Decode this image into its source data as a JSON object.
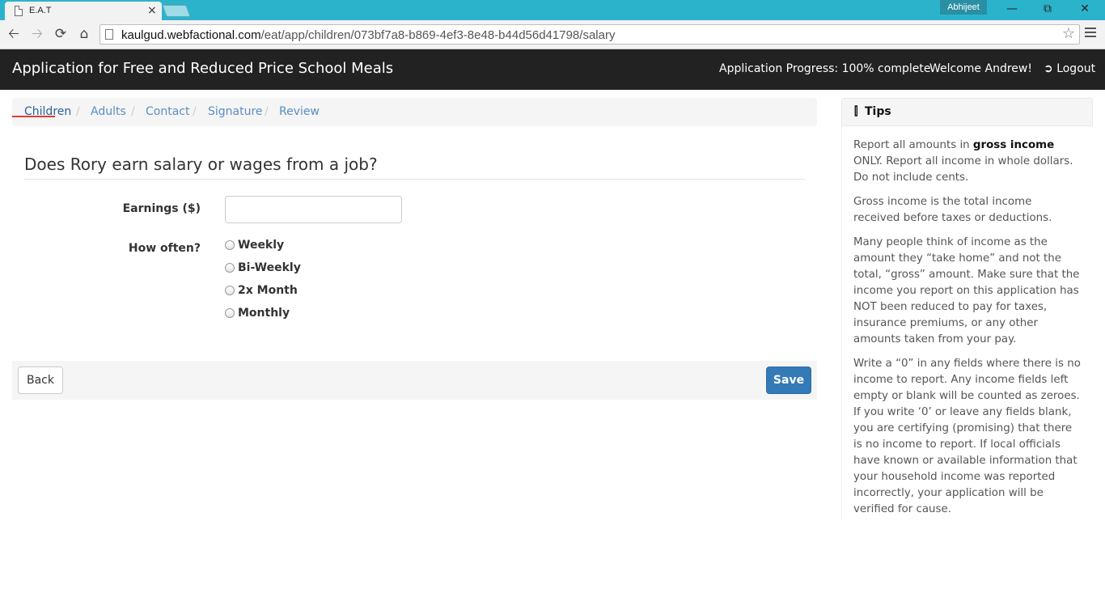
{
  "browser": {
    "tab_title": "E.A.T",
    "tab_close": "×",
    "profile_name": "Abhijeet",
    "url_host": "kaulgud.webfactional.com",
    "url_path": "/eat/app/children/073bf7a8-b869-4ef3-8e48-b44d56d41798/salary"
  },
  "navbar": {
    "brand": "Application for Free and Reduced Price School Meals",
    "progress": "Application Progress: 100% complete",
    "welcome": "Welcome Andrew!",
    "logout": "Logout"
  },
  "breadcrumb": {
    "items": [
      "Children",
      "Adults",
      "Contact",
      "Signature",
      "Review"
    ],
    "separator": "/"
  },
  "form": {
    "question": "Does Rory earn salary or wages from a job?",
    "earnings_label": "Earnings ($)",
    "earnings_value": "",
    "how_often_label": "How often?",
    "frequency_options": [
      "Weekly",
      "Bi-Weekly",
      "2x Month",
      "Monthly"
    ]
  },
  "actions": {
    "back": "Back",
    "save": "Save"
  },
  "tips": {
    "title": "Tips",
    "p1_pre": "Report all amounts in ",
    "p1_bold": "gross income",
    "p1_post": " ONLY. Report all income in whole dollars. Do not include cents.",
    "p2": "Gross income is the total income received before taxes or deductions.",
    "p3": "Many people think of income as the amount they “take home” and not the total, “gross” amount. Make sure that the income you report on this application has NOT been reduced to pay for taxes, insurance premiums, or any other amounts taken from your pay.",
    "p4": "Write a “0” in any fields where there is no income to report. Any income fields left empty or blank will be counted as zeroes. If you write ‘0’ or leave any fields blank, you are certifying (promising) that there is no income to report. If local officials have known or available information that your household income was reported incorrectly, your application will be verified for cause."
  },
  "colors": {
    "titlebar": "#2cb3cc",
    "navbar": "#222222",
    "link": "#5a8ec2",
    "active_underline": "#e03a3a",
    "primary_button": "#337ab7"
  }
}
